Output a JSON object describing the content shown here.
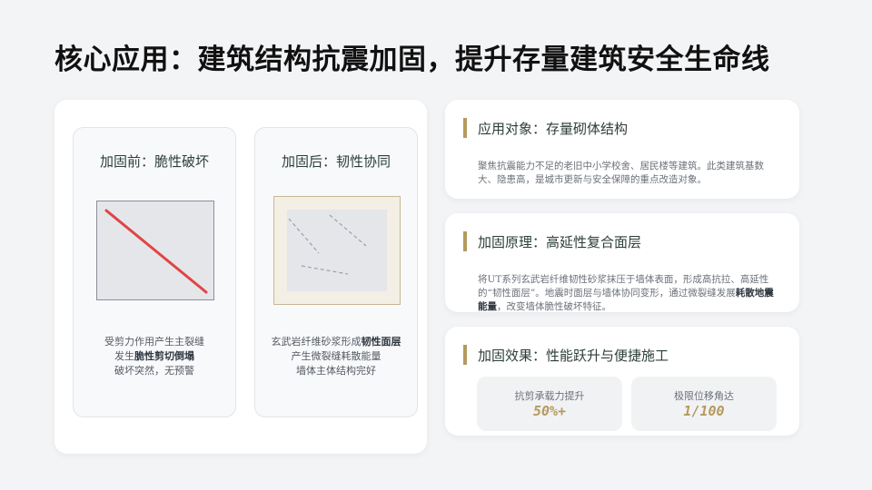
{
  "title": "核心应用：建筑结构抗震加固，提升存量建筑安全生命线",
  "colors": {
    "accent": "#b59a5e",
    "crack": "#e04545",
    "crack_dash": "#9aa0aa"
  },
  "before": {
    "title": "加固前：脆性破坏",
    "desc_line1": "受剪力作用产生主裂缝",
    "desc_line2_prefix": "发生",
    "desc_line2_bold": "脆性剪切倒塌",
    "desc_line3": "破坏突然，无预警"
  },
  "after": {
    "title": "加固后：韧性协同",
    "desc_line1_prefix": "玄武岩纤维砂浆形成",
    "desc_line1_bold": "韧性面层",
    "desc_line2": "产生微裂缝耗散能量",
    "desc_line3": "墙体主体结构完好"
  },
  "info": [
    {
      "title": "应用对象：存量砌体结构",
      "body": "聚焦抗震能力不足的老旧中小学校舍、居民楼等建筑。此类建筑基数大、隐患高，是城市更新与安全保障的重点改造对象。"
    },
    {
      "title": "加固原理：高延性复合面层",
      "body_prefix": "将UT系列玄武岩纤维韧性砂浆抹压于墙体表面，形成高抗拉、高延性的“韧性面层”。地震时面层与墙体协同变形，通过微裂缝发展",
      "body_bold": "耗散地震能量",
      "body_suffix": "，改变墙体脆性破坏特征。"
    },
    {
      "title": "加固效果：性能跃升与便捷施工",
      "stats": [
        {
          "label": "抗剪承载力提升",
          "value": "50%+"
        },
        {
          "label": "极限位移角达",
          "value": "1/100"
        }
      ]
    }
  ]
}
